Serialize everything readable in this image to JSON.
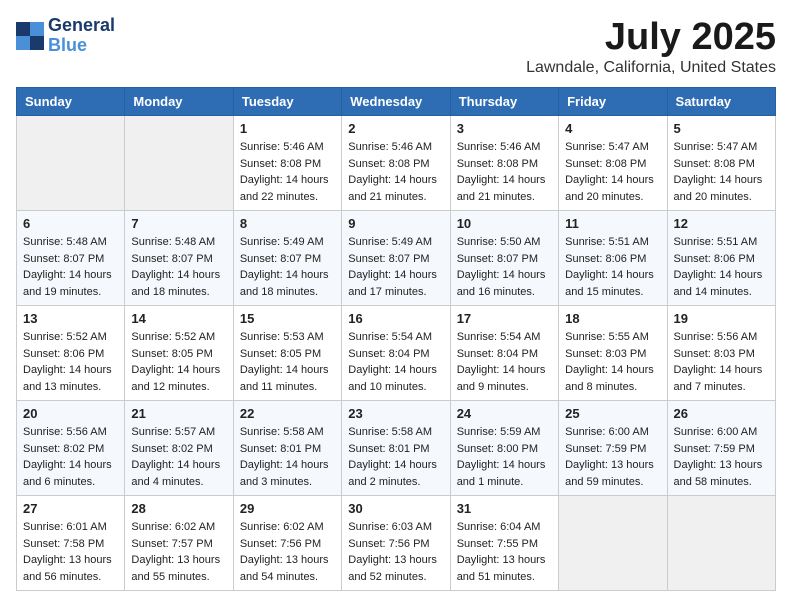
{
  "header": {
    "logo_line1": "General",
    "logo_line2": "Blue",
    "month": "July 2025",
    "location": "Lawndale, California, United States"
  },
  "days_of_week": [
    "Sunday",
    "Monday",
    "Tuesday",
    "Wednesday",
    "Thursday",
    "Friday",
    "Saturday"
  ],
  "weeks": [
    [
      {
        "day": "",
        "info": ""
      },
      {
        "day": "",
        "info": ""
      },
      {
        "day": "1",
        "info": "Sunrise: 5:46 AM\nSunset: 8:08 PM\nDaylight: 14 hours and 22 minutes."
      },
      {
        "day": "2",
        "info": "Sunrise: 5:46 AM\nSunset: 8:08 PM\nDaylight: 14 hours and 21 minutes."
      },
      {
        "day": "3",
        "info": "Sunrise: 5:46 AM\nSunset: 8:08 PM\nDaylight: 14 hours and 21 minutes."
      },
      {
        "day": "4",
        "info": "Sunrise: 5:47 AM\nSunset: 8:08 PM\nDaylight: 14 hours and 20 minutes."
      },
      {
        "day": "5",
        "info": "Sunrise: 5:47 AM\nSunset: 8:08 PM\nDaylight: 14 hours and 20 minutes."
      }
    ],
    [
      {
        "day": "6",
        "info": "Sunrise: 5:48 AM\nSunset: 8:07 PM\nDaylight: 14 hours and 19 minutes."
      },
      {
        "day": "7",
        "info": "Sunrise: 5:48 AM\nSunset: 8:07 PM\nDaylight: 14 hours and 18 minutes."
      },
      {
        "day": "8",
        "info": "Sunrise: 5:49 AM\nSunset: 8:07 PM\nDaylight: 14 hours and 18 minutes."
      },
      {
        "day": "9",
        "info": "Sunrise: 5:49 AM\nSunset: 8:07 PM\nDaylight: 14 hours and 17 minutes."
      },
      {
        "day": "10",
        "info": "Sunrise: 5:50 AM\nSunset: 8:07 PM\nDaylight: 14 hours and 16 minutes."
      },
      {
        "day": "11",
        "info": "Sunrise: 5:51 AM\nSunset: 8:06 PM\nDaylight: 14 hours and 15 minutes."
      },
      {
        "day": "12",
        "info": "Sunrise: 5:51 AM\nSunset: 8:06 PM\nDaylight: 14 hours and 14 minutes."
      }
    ],
    [
      {
        "day": "13",
        "info": "Sunrise: 5:52 AM\nSunset: 8:06 PM\nDaylight: 14 hours and 13 minutes."
      },
      {
        "day": "14",
        "info": "Sunrise: 5:52 AM\nSunset: 8:05 PM\nDaylight: 14 hours and 12 minutes."
      },
      {
        "day": "15",
        "info": "Sunrise: 5:53 AM\nSunset: 8:05 PM\nDaylight: 14 hours and 11 minutes."
      },
      {
        "day": "16",
        "info": "Sunrise: 5:54 AM\nSunset: 8:04 PM\nDaylight: 14 hours and 10 minutes."
      },
      {
        "day": "17",
        "info": "Sunrise: 5:54 AM\nSunset: 8:04 PM\nDaylight: 14 hours and 9 minutes."
      },
      {
        "day": "18",
        "info": "Sunrise: 5:55 AM\nSunset: 8:03 PM\nDaylight: 14 hours and 8 minutes."
      },
      {
        "day": "19",
        "info": "Sunrise: 5:56 AM\nSunset: 8:03 PM\nDaylight: 14 hours and 7 minutes."
      }
    ],
    [
      {
        "day": "20",
        "info": "Sunrise: 5:56 AM\nSunset: 8:02 PM\nDaylight: 14 hours and 6 minutes."
      },
      {
        "day": "21",
        "info": "Sunrise: 5:57 AM\nSunset: 8:02 PM\nDaylight: 14 hours and 4 minutes."
      },
      {
        "day": "22",
        "info": "Sunrise: 5:58 AM\nSunset: 8:01 PM\nDaylight: 14 hours and 3 minutes."
      },
      {
        "day": "23",
        "info": "Sunrise: 5:58 AM\nSunset: 8:01 PM\nDaylight: 14 hours and 2 minutes."
      },
      {
        "day": "24",
        "info": "Sunrise: 5:59 AM\nSunset: 8:00 PM\nDaylight: 14 hours and 1 minute."
      },
      {
        "day": "25",
        "info": "Sunrise: 6:00 AM\nSunset: 7:59 PM\nDaylight: 13 hours and 59 minutes."
      },
      {
        "day": "26",
        "info": "Sunrise: 6:00 AM\nSunset: 7:59 PM\nDaylight: 13 hours and 58 minutes."
      }
    ],
    [
      {
        "day": "27",
        "info": "Sunrise: 6:01 AM\nSunset: 7:58 PM\nDaylight: 13 hours and 56 minutes."
      },
      {
        "day": "28",
        "info": "Sunrise: 6:02 AM\nSunset: 7:57 PM\nDaylight: 13 hours and 55 minutes."
      },
      {
        "day": "29",
        "info": "Sunrise: 6:02 AM\nSunset: 7:56 PM\nDaylight: 13 hours and 54 minutes."
      },
      {
        "day": "30",
        "info": "Sunrise: 6:03 AM\nSunset: 7:56 PM\nDaylight: 13 hours and 52 minutes."
      },
      {
        "day": "31",
        "info": "Sunrise: 6:04 AM\nSunset: 7:55 PM\nDaylight: 13 hours and 51 minutes."
      },
      {
        "day": "",
        "info": ""
      },
      {
        "day": "",
        "info": ""
      }
    ]
  ]
}
